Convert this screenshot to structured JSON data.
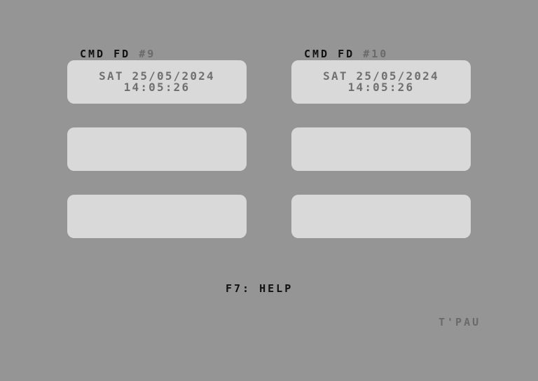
{
  "panels": [
    {
      "label_prefix": "CMD FD",
      "label_number": "#9",
      "day": "SAT",
      "date": "25/05/2024",
      "time": "14:05:26"
    },
    {
      "label_prefix": "CMD FD",
      "label_number": "#10",
      "day": "SAT",
      "date": "25/05/2024",
      "time": "14:05:26"
    }
  ],
  "footer": {
    "help_text": "F7: HELP",
    "credit": "T'PAU"
  }
}
